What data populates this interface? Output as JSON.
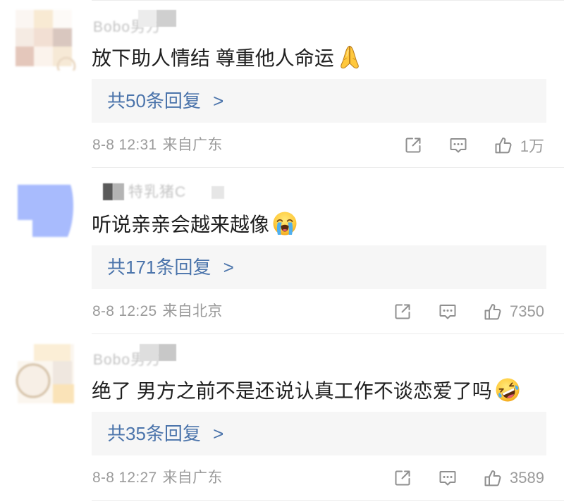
{
  "comments": [
    {
      "username": "Bobo男方",
      "text": "放下助人情结 尊重他人命运",
      "emoji_icon": "folded-hands-emoji-icon",
      "reply_label": "共50条回复 >",
      "time": "8-8 12:31",
      "location": "来自广东",
      "like_count": "1万"
    },
    {
      "username": "特乳猪C",
      "text": "听说亲亲会越来越像",
      "emoji_icon": "loudly-crying-face-emoji-icon",
      "reply_label": "共171条回复 >",
      "time": "8-8 12:25",
      "location": "来自北京",
      "like_count": "7350"
    },
    {
      "username": "Bobo男方",
      "text": "绝了 男方之前不是还说认真工作不谈恋爱了吗",
      "emoji_icon": "rolling-on-the-floor-laughing-emoji-icon",
      "reply_label": "共35条回复 >",
      "time": "8-8 12:27",
      "location": "来自广东",
      "like_count": "3589"
    }
  ],
  "icons": {
    "share": "share-icon",
    "comment": "comment-icon",
    "like": "thumbs-up-icon",
    "avatar": "mosaic-avatar"
  },
  "colors": {
    "text": "#1f1f1f",
    "link": "#4b74ab",
    "meta": "#9b9b9b",
    "reply_background": "#f6f6f6",
    "divider": "#ececec",
    "icon": "#8f8f8f"
  }
}
